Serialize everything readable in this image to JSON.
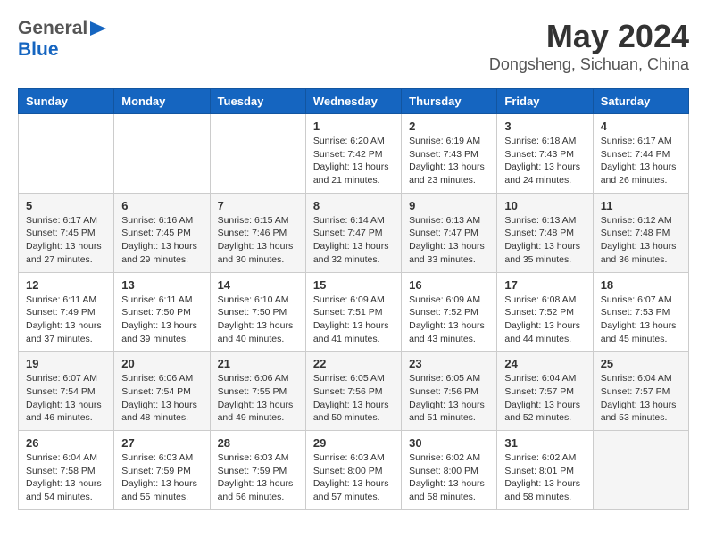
{
  "header": {
    "logo_line1": "General",
    "logo_line2": "Blue",
    "main_title": "May 2024",
    "subtitle": "Dongsheng, Sichuan, China"
  },
  "calendar": {
    "days_of_week": [
      "Sunday",
      "Monday",
      "Tuesday",
      "Wednesday",
      "Thursday",
      "Friday",
      "Saturday"
    ],
    "weeks": [
      [
        {
          "date": "",
          "info": ""
        },
        {
          "date": "",
          "info": ""
        },
        {
          "date": "",
          "info": ""
        },
        {
          "date": "1",
          "info": "Sunrise: 6:20 AM\nSunset: 7:42 PM\nDaylight: 13 hours and 21 minutes."
        },
        {
          "date": "2",
          "info": "Sunrise: 6:19 AM\nSunset: 7:43 PM\nDaylight: 13 hours and 23 minutes."
        },
        {
          "date": "3",
          "info": "Sunrise: 6:18 AM\nSunset: 7:43 PM\nDaylight: 13 hours and 24 minutes."
        },
        {
          "date": "4",
          "info": "Sunrise: 6:17 AM\nSunset: 7:44 PM\nDaylight: 13 hours and 26 minutes."
        }
      ],
      [
        {
          "date": "5",
          "info": "Sunrise: 6:17 AM\nSunset: 7:45 PM\nDaylight: 13 hours and 27 minutes."
        },
        {
          "date": "6",
          "info": "Sunrise: 6:16 AM\nSunset: 7:45 PM\nDaylight: 13 hours and 29 minutes."
        },
        {
          "date": "7",
          "info": "Sunrise: 6:15 AM\nSunset: 7:46 PM\nDaylight: 13 hours and 30 minutes."
        },
        {
          "date": "8",
          "info": "Sunrise: 6:14 AM\nSunset: 7:47 PM\nDaylight: 13 hours and 32 minutes."
        },
        {
          "date": "9",
          "info": "Sunrise: 6:13 AM\nSunset: 7:47 PM\nDaylight: 13 hours and 33 minutes."
        },
        {
          "date": "10",
          "info": "Sunrise: 6:13 AM\nSunset: 7:48 PM\nDaylight: 13 hours and 35 minutes."
        },
        {
          "date": "11",
          "info": "Sunrise: 6:12 AM\nSunset: 7:48 PM\nDaylight: 13 hours and 36 minutes."
        }
      ],
      [
        {
          "date": "12",
          "info": "Sunrise: 6:11 AM\nSunset: 7:49 PM\nDaylight: 13 hours and 37 minutes."
        },
        {
          "date": "13",
          "info": "Sunrise: 6:11 AM\nSunset: 7:50 PM\nDaylight: 13 hours and 39 minutes."
        },
        {
          "date": "14",
          "info": "Sunrise: 6:10 AM\nSunset: 7:50 PM\nDaylight: 13 hours and 40 minutes."
        },
        {
          "date": "15",
          "info": "Sunrise: 6:09 AM\nSunset: 7:51 PM\nDaylight: 13 hours and 41 minutes."
        },
        {
          "date": "16",
          "info": "Sunrise: 6:09 AM\nSunset: 7:52 PM\nDaylight: 13 hours and 43 minutes."
        },
        {
          "date": "17",
          "info": "Sunrise: 6:08 AM\nSunset: 7:52 PM\nDaylight: 13 hours and 44 minutes."
        },
        {
          "date": "18",
          "info": "Sunrise: 6:07 AM\nSunset: 7:53 PM\nDaylight: 13 hours and 45 minutes."
        }
      ],
      [
        {
          "date": "19",
          "info": "Sunrise: 6:07 AM\nSunset: 7:54 PM\nDaylight: 13 hours and 46 minutes."
        },
        {
          "date": "20",
          "info": "Sunrise: 6:06 AM\nSunset: 7:54 PM\nDaylight: 13 hours and 48 minutes."
        },
        {
          "date": "21",
          "info": "Sunrise: 6:06 AM\nSunset: 7:55 PM\nDaylight: 13 hours and 49 minutes."
        },
        {
          "date": "22",
          "info": "Sunrise: 6:05 AM\nSunset: 7:56 PM\nDaylight: 13 hours and 50 minutes."
        },
        {
          "date": "23",
          "info": "Sunrise: 6:05 AM\nSunset: 7:56 PM\nDaylight: 13 hours and 51 minutes."
        },
        {
          "date": "24",
          "info": "Sunrise: 6:04 AM\nSunset: 7:57 PM\nDaylight: 13 hours and 52 minutes."
        },
        {
          "date": "25",
          "info": "Sunrise: 6:04 AM\nSunset: 7:57 PM\nDaylight: 13 hours and 53 minutes."
        }
      ],
      [
        {
          "date": "26",
          "info": "Sunrise: 6:04 AM\nSunset: 7:58 PM\nDaylight: 13 hours and 54 minutes."
        },
        {
          "date": "27",
          "info": "Sunrise: 6:03 AM\nSunset: 7:59 PM\nDaylight: 13 hours and 55 minutes."
        },
        {
          "date": "28",
          "info": "Sunrise: 6:03 AM\nSunset: 7:59 PM\nDaylight: 13 hours and 56 minutes."
        },
        {
          "date": "29",
          "info": "Sunrise: 6:03 AM\nSunset: 8:00 PM\nDaylight: 13 hours and 57 minutes."
        },
        {
          "date": "30",
          "info": "Sunrise: 6:02 AM\nSunset: 8:00 PM\nDaylight: 13 hours and 58 minutes."
        },
        {
          "date": "31",
          "info": "Sunrise: 6:02 AM\nSunset: 8:01 PM\nDaylight: 13 hours and 58 minutes."
        },
        {
          "date": "",
          "info": ""
        }
      ]
    ]
  }
}
